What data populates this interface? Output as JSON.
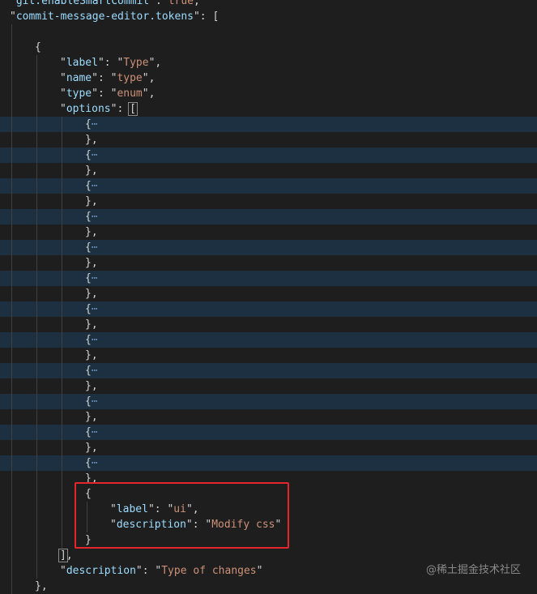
{
  "editor": {
    "lines": {
      "l0": {
        "key": "git.enableSmartCommit",
        "value": "true"
      },
      "l1": {
        "key": "commit-message-editor.tokens"
      },
      "l4": {
        "key": "label",
        "value": "Type"
      },
      "l5": {
        "key": "name",
        "value": "type"
      },
      "l6": {
        "key": "type",
        "value": "enum"
      },
      "l7": {
        "key": "options"
      },
      "l32": {
        "key": "label",
        "value": "ui"
      },
      "l33": {
        "key": "description",
        "value": "Modify css"
      },
      "l36": {
        "key": "description",
        "value": "Type of changes"
      }
    },
    "collapsed_marker": "⋯",
    "collapsed_count": 12
  },
  "watermark": "@稀土掘金技术社区",
  "colors": {
    "background": "#1e1e1e",
    "key": "#9cdcfe",
    "string": "#ce9178",
    "punctuation": "#d4d4d4",
    "folded_line_highlight": "#1d3041",
    "annotation_box": "#e3262b"
  }
}
